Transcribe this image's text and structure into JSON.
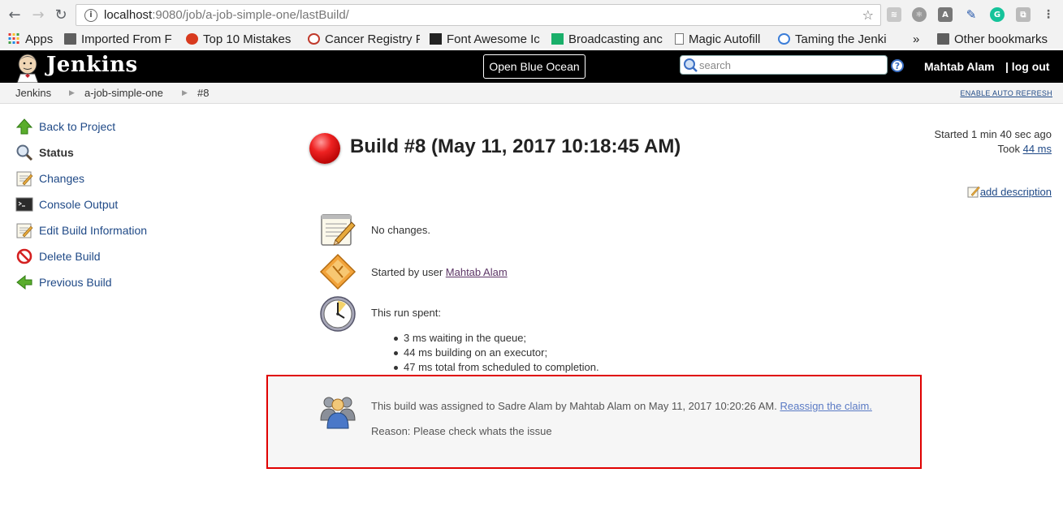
{
  "browser": {
    "url_host": "localhost",
    "url_path": ":9080/job/a-job-simple-one/lastBuild/",
    "bookmarks": [
      {
        "label": "Apps",
        "icon": "apps-grid-icon"
      },
      {
        "label": "Imported From F",
        "icon": "folder-icon"
      },
      {
        "label": "Top 10 Mistakes",
        "icon": "site-favicon-icon"
      },
      {
        "label": "Cancer Registry F",
        "icon": "site-favicon-icon"
      },
      {
        "label": "Font Awesome Ic",
        "icon": "flag-icon"
      },
      {
        "label": "Broadcasting anc",
        "icon": "site-favicon-icon"
      },
      {
        "label": "Magic Autofill",
        "icon": "page-icon"
      },
      {
        "label": "Taming the Jenki",
        "icon": "site-favicon-icon"
      },
      {
        "label": "»",
        "icon": ""
      },
      {
        "label": "Other bookmarks",
        "icon": "folder-icon"
      }
    ]
  },
  "header": {
    "title": "Jenkins",
    "blue_ocean": "Open Blue Ocean",
    "search_placeholder": "search",
    "user": "Mahtab Alam",
    "logout": "| log out"
  },
  "breadcrumb": {
    "items": [
      "Jenkins",
      "a-job-simple-one",
      "#8"
    ],
    "auto_refresh": "ENABLE AUTO REFRESH"
  },
  "sidebar": {
    "items": [
      {
        "label": "Back to Project",
        "icon": "up-arrow-icon"
      },
      {
        "label": "Status",
        "icon": "magnifier-icon"
      },
      {
        "label": "Changes",
        "icon": "notepad-icon"
      },
      {
        "label": "Console Output",
        "icon": "terminal-icon"
      },
      {
        "label": "Edit Build Information",
        "icon": "notepad-icon"
      },
      {
        "label": "Delete Build",
        "icon": "no-entry-icon"
      },
      {
        "label": "Previous Build",
        "icon": "left-arrow-icon"
      }
    ]
  },
  "build": {
    "title": "Build #8 (May 11, 2017 10:18:45 AM)",
    "status_color": "#e62020",
    "started": "Started 1 min 40 sec ago",
    "took_prefix": "Took ",
    "took_value": "44 ms",
    "add_description": "add description",
    "changes": "No changes.",
    "started_by_prefix": "Started by user ",
    "started_by_user": "Mahtab Alam",
    "run_spent": "This run spent:",
    "spent_items": [
      "3 ms waiting in the queue;",
      "44 ms building on an executor;",
      "47 ms total from scheduled to completion."
    ]
  },
  "claim": {
    "text": "This build was assigned to Sadre Alam by Mahtab Alam on May 11, 2017 10:20:26 AM. ",
    "reassign": "Reassign the claim.",
    "reason": "Reason: Please check whats the issue",
    "highlight_color": "#e00000"
  }
}
